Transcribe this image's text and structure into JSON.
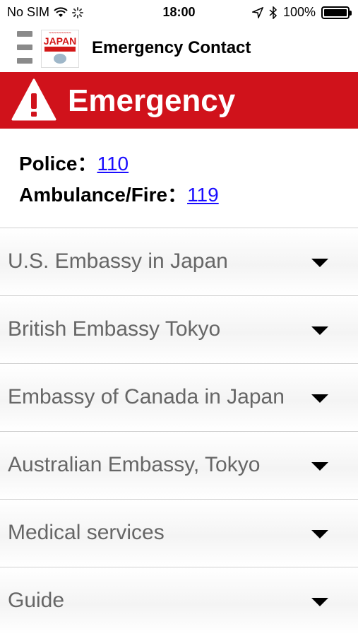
{
  "status_bar": {
    "carrier": "No SIM",
    "time": "18:00",
    "battery": "100%"
  },
  "header": {
    "title": "Emergency Contact",
    "logo_text": "JAPAN"
  },
  "banner": {
    "title": "Emergency",
    "color": "#d0121b"
  },
  "contacts": [
    {
      "label": "Police：",
      "number": "110"
    },
    {
      "label": "Ambulance/Fire：",
      "number": "119"
    }
  ],
  "accordion": [
    {
      "label": "U.S. Embassy in Japan"
    },
    {
      "label": "British Embassy Tokyo"
    },
    {
      "label": "Embassy of Canada in Japan"
    },
    {
      "label": "Australian Embassy, Tokyo"
    },
    {
      "label": "Medical services"
    },
    {
      "label": "Guide"
    }
  ]
}
